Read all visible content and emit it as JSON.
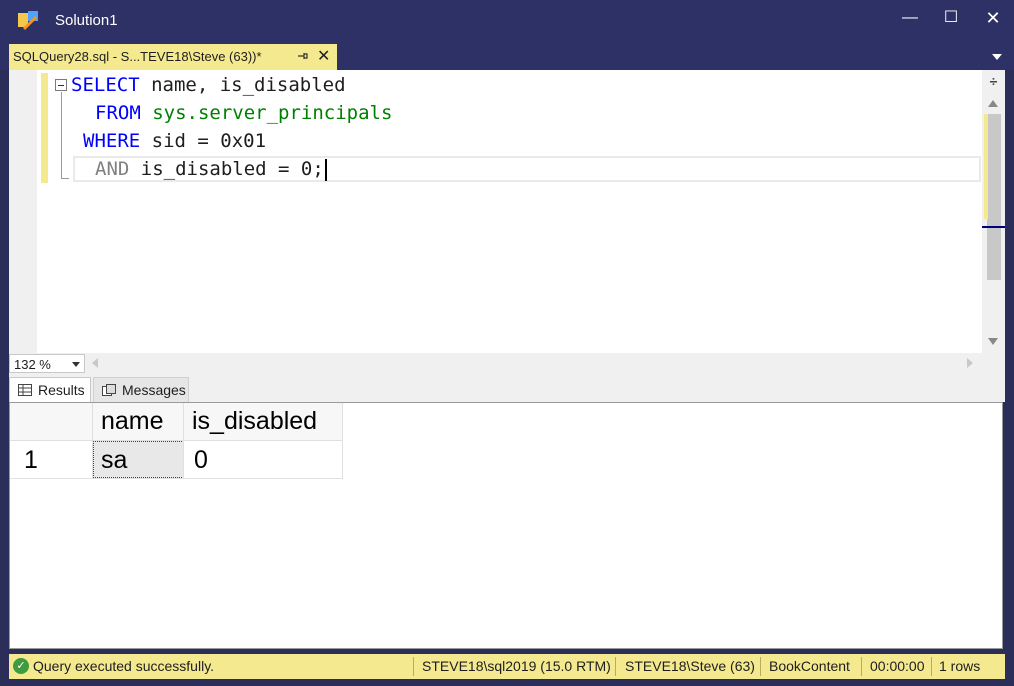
{
  "window": {
    "title": "Solution1",
    "minimize": "—",
    "maximize": "☐",
    "close": "✕"
  },
  "tab": {
    "label": "SQLQuery28.sql - S...TEVE18\\Steve (63))*",
    "close": "✕"
  },
  "editor": {
    "lines": [
      {
        "kw1": "SELECT",
        "rest": " name, is_disabled"
      },
      {
        "kw1": "FROM",
        "sys": " sys.server_principals"
      },
      {
        "kw1": "WHERE",
        "rest": " sid = 0x01"
      },
      {
        "kw1": "AND",
        "rest": " is_disabled = 0;"
      }
    ],
    "zoom": "132 %"
  },
  "results_tabs": {
    "results": "Results",
    "messages": "Messages"
  },
  "grid": {
    "columns": [
      "name",
      "is_disabled"
    ],
    "rows": [
      {
        "num": "1",
        "cells": [
          "sa",
          "0"
        ]
      }
    ]
  },
  "status": {
    "message": "Query executed successfully.",
    "server": "STEVE18\\sql2019 (15.0 RTM)",
    "user": "STEVE18\\Steve (63)",
    "database": "BookContent",
    "time": "00:00:00",
    "rows": "1 rows"
  }
}
